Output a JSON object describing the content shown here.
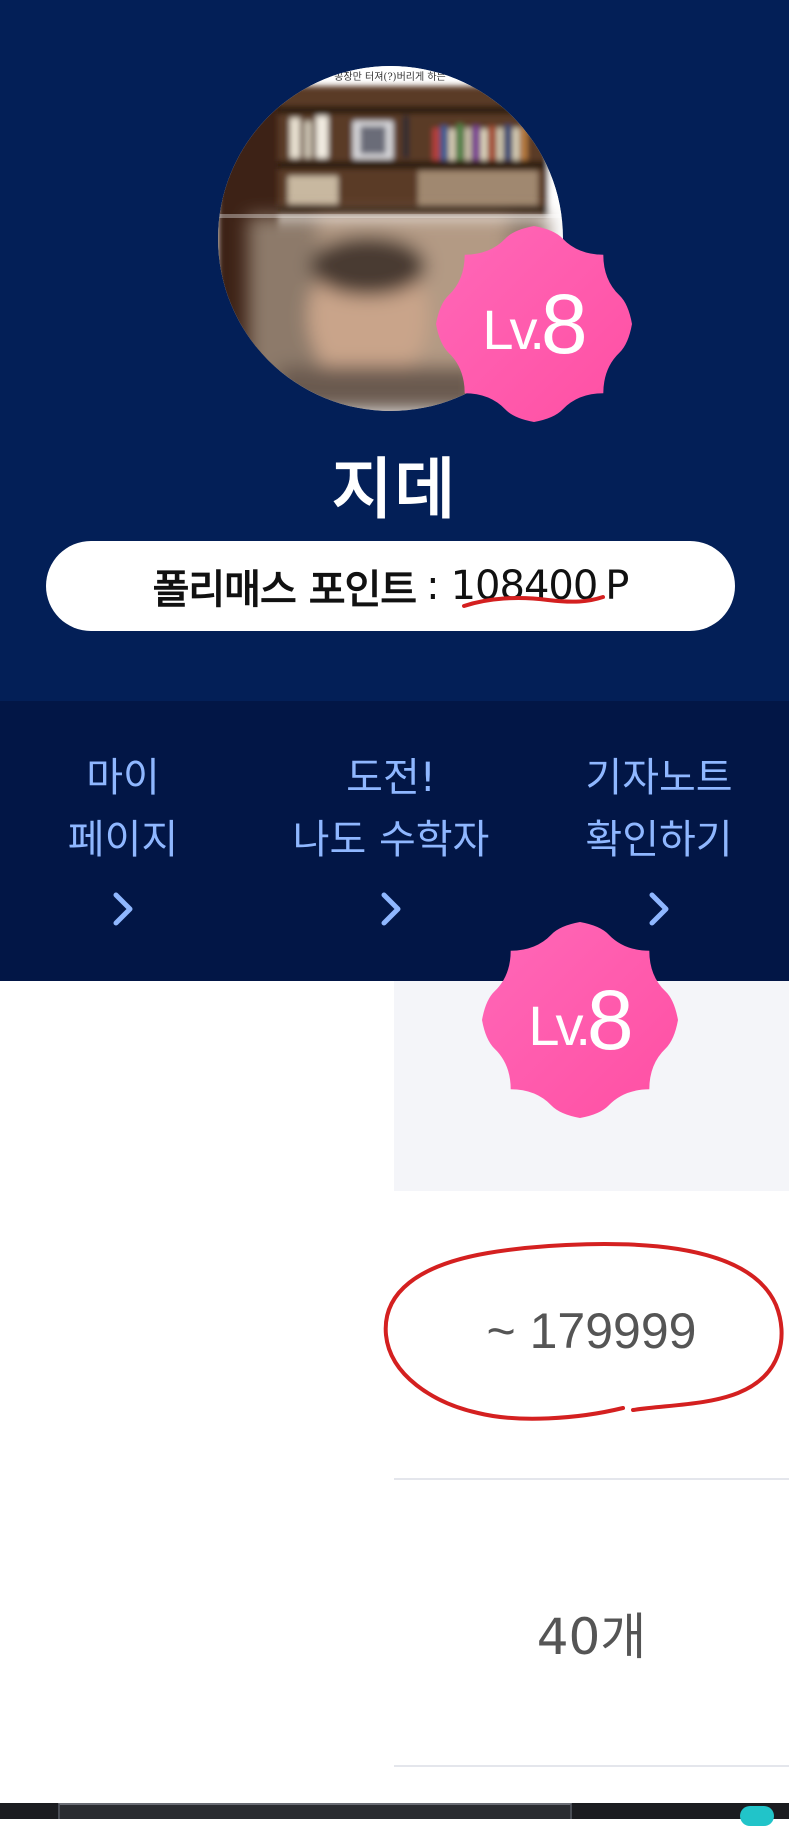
{
  "profile": {
    "name": "지데",
    "level_prefix": "Lv.",
    "level_number": "8",
    "avatar_caption": "공장만 터져(?)버리게 하는"
  },
  "points": {
    "label": "폴리매스 포인트",
    "separator": ":",
    "value": "108400",
    "unit": "P"
  },
  "nav": [
    {
      "line1": "마이",
      "line2": "페이지",
      "icon": "chevron-right-icon"
    },
    {
      "line1": "도전!",
      "line2": "나도 수학자",
      "icon": "chevron-right-icon"
    },
    {
      "line1": "기자노트",
      "line2": "확인하기",
      "icon": "chevron-right-icon"
    }
  ],
  "level_table": {
    "level_prefix": "Lv.",
    "level_number": "8",
    "point_range": "~ 179999",
    "count": "40개"
  },
  "colors": {
    "header_bg": "#031f57",
    "nav_bg": "#021646",
    "nav_text": "#8fb7ff",
    "badge_pink": "#ff5fae",
    "annotation_red": "#d42020"
  }
}
